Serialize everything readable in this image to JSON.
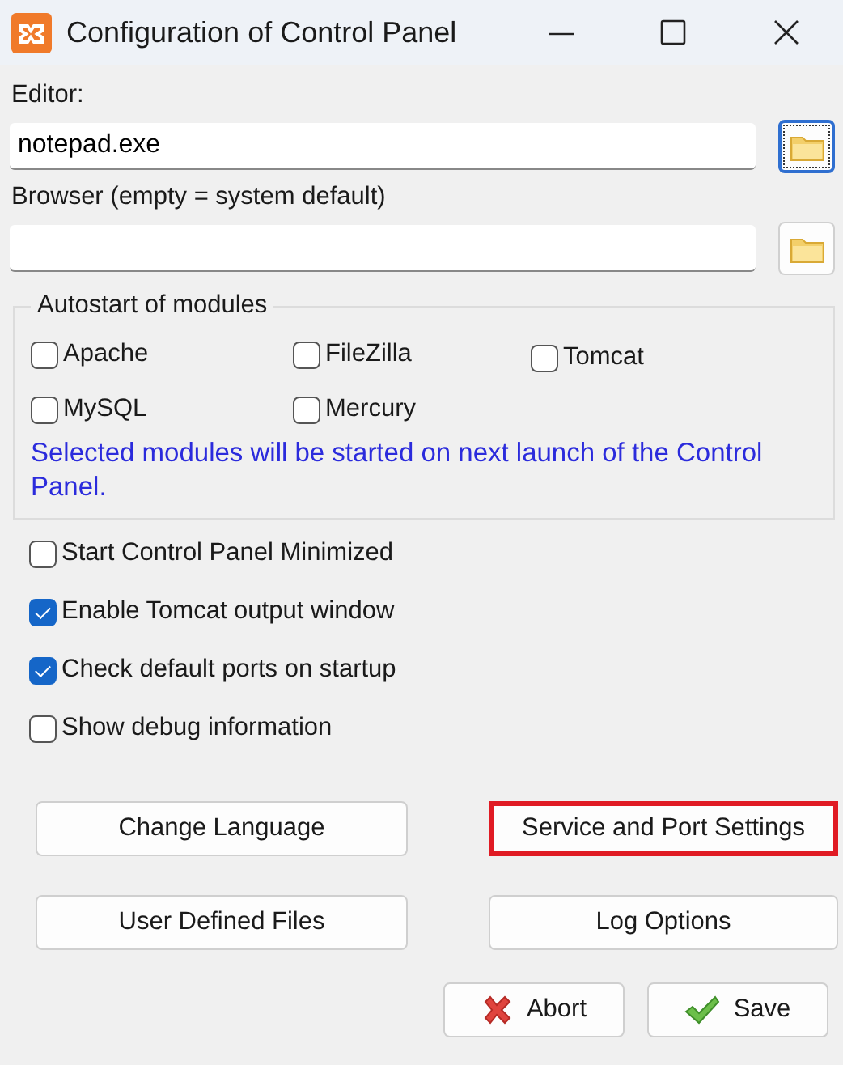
{
  "window": {
    "title": "Configuration of Control Panel"
  },
  "editor": {
    "label": "Editor:",
    "value": "notepad.exe",
    "browse_focused": true
  },
  "browser": {
    "label": "Browser (empty = system default)",
    "browse_focused": false
  },
  "autostart": {
    "title": "Autostart of modules",
    "modules": [
      {
        "label": "Apache",
        "checked": false
      },
      {
        "label": "FileZilla",
        "checked": false
      },
      {
        "label": "Tomcat",
        "checked": false
      },
      {
        "label": "MySQL",
        "checked": false
      },
      {
        "label": "Mercury",
        "checked": false
      }
    ],
    "note": "Selected modules will be started on next launch of the Control Panel."
  },
  "options": [
    {
      "label": "Start Control Panel Minimized",
      "checked": false
    },
    {
      "label": "Enable Tomcat output window",
      "checked": true
    },
    {
      "label": "Check default ports on startup",
      "checked": true
    },
    {
      "label": "Show debug information",
      "checked": false
    }
  ],
  "buttons": [
    {
      "label": "Change Language",
      "highlighted": false
    },
    {
      "label": "Service and Port Settings",
      "highlighted": true
    },
    {
      "label": "User Defined Files",
      "highlighted": false
    },
    {
      "label": "Log Options",
      "highlighted": false
    }
  ],
  "actions": [
    {
      "label": "Abort",
      "kind": "abort"
    },
    {
      "label": "Save",
      "kind": "save"
    }
  ]
}
